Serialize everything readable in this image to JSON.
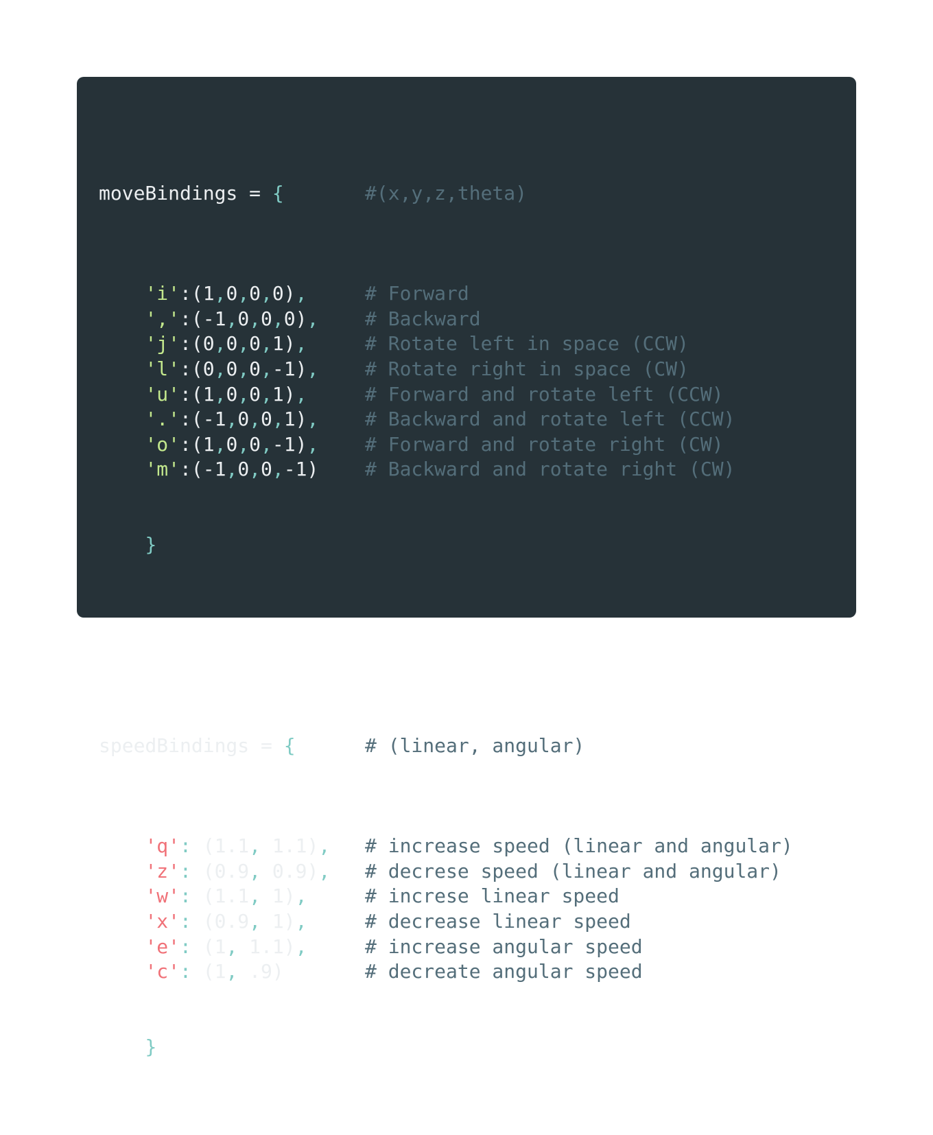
{
  "move": {
    "var_name": "moveBindings",
    "header_comment": "#(x,y,z,theta)",
    "rows": [
      {
        "key": "'i'",
        "value": [
          "1",
          "0",
          "0",
          "0"
        ],
        "trailing": ",",
        "comment": "# Forward"
      },
      {
        "key": "','",
        "value": [
          "-1",
          "0",
          "0",
          "0"
        ],
        "trailing": ",",
        "comment": "# Backward"
      },
      {
        "key": "'j'",
        "value": [
          "0",
          "0",
          "0",
          "1"
        ],
        "trailing": ",",
        "comment": "# Rotate left in space (CCW)"
      },
      {
        "key": "'l'",
        "value": [
          "0",
          "0",
          "0",
          "-1"
        ],
        "trailing": ",",
        "comment": "# Rotate right in space (CW)"
      },
      {
        "key": "'u'",
        "value": [
          "1",
          "0",
          "0",
          "1"
        ],
        "trailing": ",",
        "comment": "# Forward and rotate left (CCW)"
      },
      {
        "key": "'.'",
        "value": [
          "-1",
          "0",
          "0",
          "1"
        ],
        "trailing": ",",
        "comment": "# Backward and rotate left (CCW)"
      },
      {
        "key": "'o'",
        "value": [
          "1",
          "0",
          "0",
          "-1"
        ],
        "trailing": ",",
        "comment": "# Forward and rotate right (CW)"
      },
      {
        "key": "'m'",
        "value": [
          "-1",
          "0",
          "0",
          "-1"
        ],
        "trailing": "",
        "comment": "# Backward and rotate right (CW)"
      }
    ]
  },
  "speed": {
    "var_name": "speedBindings",
    "header_comment": "# (linear, angular)",
    "rows": [
      {
        "key": "'q'",
        "value": [
          "1.1",
          "1.1"
        ],
        "trailing": ",",
        "comment": "# increase speed (linear and angular)"
      },
      {
        "key": "'z'",
        "value": [
          "0.9",
          "0.9"
        ],
        "trailing": ",",
        "comment": "# decrese speed (linear and angular)"
      },
      {
        "key": "'w'",
        "value": [
          "1.1",
          "1"
        ],
        "trailing": ",",
        "comment": "# increse linear speed"
      },
      {
        "key": "'x'",
        "value": [
          "0.9",
          "1"
        ],
        "trailing": ",",
        "comment": "# decrease linear speed"
      },
      {
        "key": "'e'",
        "value": [
          "1",
          "1.1"
        ],
        "trailing": ",",
        "comment": "# increase angular speed"
      },
      {
        "key": "'c'",
        "value": [
          "1",
          ".9"
        ],
        "trailing": "",
        "comment": "# decreate angular speed"
      }
    ]
  },
  "colors": {
    "background": "#263238",
    "text": "#eceff1",
    "punctuation": "#80cbc4",
    "move_key": "#c3e88d",
    "speed_key": "#f07178",
    "comment": "#546e7a"
  }
}
